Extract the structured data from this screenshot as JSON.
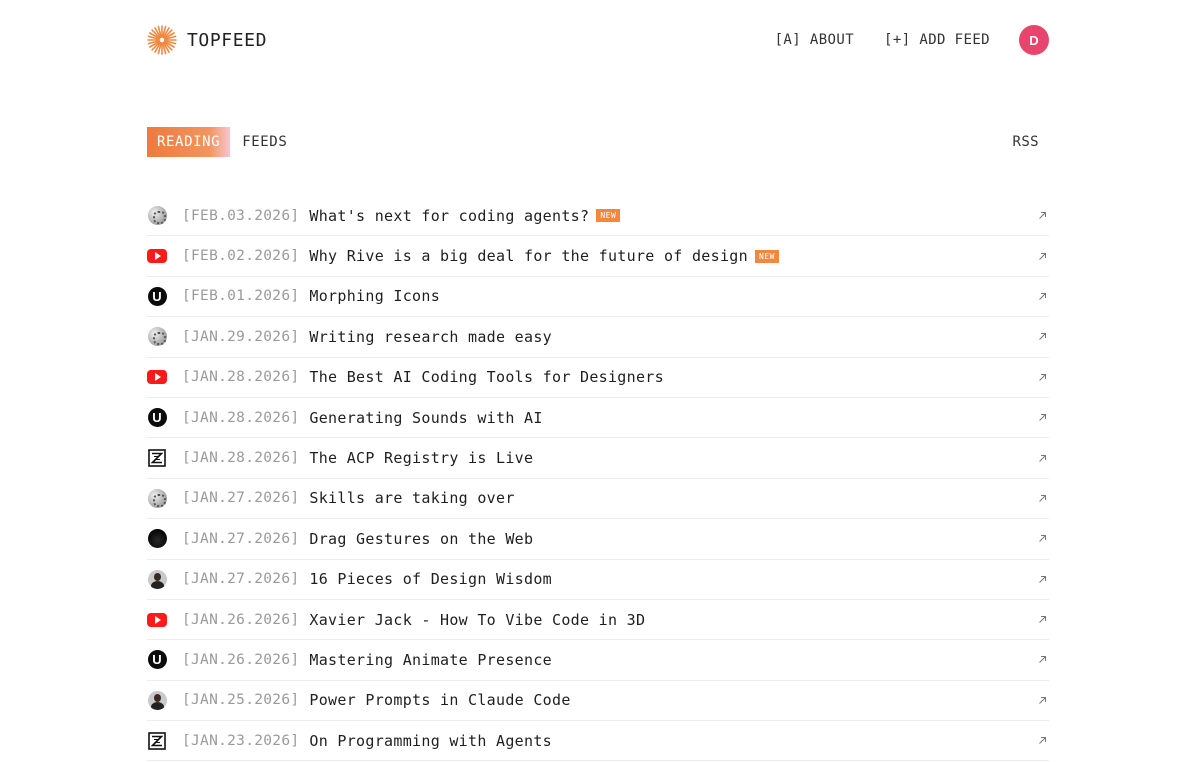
{
  "header": {
    "logo_text": "TOPFEED",
    "nav": {
      "about": "[A] ABOUT",
      "add_feed": "[+] ADD FEED"
    },
    "avatar_letter": "D"
  },
  "tabs": {
    "reading": "READING",
    "feeds": "FEEDS",
    "rss": "RSS"
  },
  "colors": {
    "accent": "#f0883f",
    "youtube_red": "#ff1a1a",
    "avatar_pink": "#e8456c",
    "date_gray": "#9a9a9a"
  },
  "items": [
    {
      "icon": "blob-icon",
      "date": "[FEB.03.2026]",
      "title": "What's next for coding agents?",
      "badge": "NEW"
    },
    {
      "icon": "youtube-icon",
      "date": "[FEB.02.2026]",
      "title": "Why Rive is a big deal for the future of design",
      "badge": "NEW"
    },
    {
      "icon": "u-icon",
      "date": "[FEB.01.2026]",
      "title": "Morphing Icons",
      "badge": ""
    },
    {
      "icon": "blob-icon",
      "date": "[JAN.29.2026]",
      "title": "Writing research made easy",
      "badge": ""
    },
    {
      "icon": "youtube-icon",
      "date": "[JAN.28.2026]",
      "title": "The Best AI Coding Tools for Designers",
      "badge": ""
    },
    {
      "icon": "u-icon",
      "date": "[JAN.28.2026]",
      "title": "Generating Sounds with AI",
      "badge": ""
    },
    {
      "icon": "zed-icon",
      "date": "[JAN.28.2026]",
      "title": "The ACP Registry is Live",
      "badge": ""
    },
    {
      "icon": "blob-icon",
      "date": "[JAN.27.2026]",
      "title": "Skills are taking over",
      "badge": ""
    },
    {
      "icon": "dark-circle-icon",
      "date": "[JAN.27.2026]",
      "title": "Drag Gestures on the Web",
      "badge": ""
    },
    {
      "icon": "person-avatar-icon",
      "date": "[JAN.27.2026]",
      "title": "16 Pieces of Design Wisdom",
      "badge": ""
    },
    {
      "icon": "youtube-icon",
      "date": "[JAN.26.2026]",
      "title": "Xavier Jack - How To Vibe Code in 3D",
      "badge": ""
    },
    {
      "icon": "u-icon",
      "date": "[JAN.26.2026]",
      "title": "Mastering Animate Presence",
      "badge": ""
    },
    {
      "icon": "person-avatar-icon",
      "date": "[JAN.25.2026]",
      "title": "Power Prompts in Claude Code",
      "badge": ""
    },
    {
      "icon": "zed-icon",
      "date": "[JAN.23.2026]",
      "title": "On Programming with Agents",
      "badge": ""
    }
  ]
}
